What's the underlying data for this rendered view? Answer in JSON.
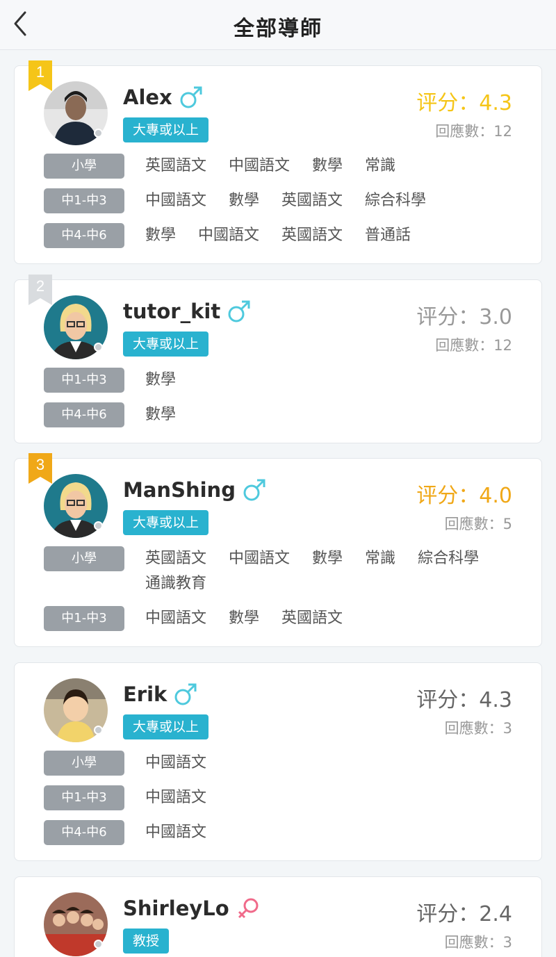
{
  "header": {
    "title": "全部導師"
  },
  "colors": {
    "accent": "#29b2cf",
    "gold": "#f5c518",
    "silver": "#d9dcdf",
    "bronze": "#f0a818",
    "male": "#4ec9dd",
    "female": "#f06a8a"
  },
  "tutors": [
    {
      "rank": "1",
      "name": "Alex",
      "gender": "male",
      "education": "大專或以上",
      "score": "评分：4.3",
      "responses": "回應數：12",
      "levels": [
        {
          "label": "小學",
          "subjects": [
            "英國語文",
            "中國語文",
            "數學",
            "常識"
          ]
        },
        {
          "label": "中1-中3",
          "subjects": [
            "中國語文",
            "數學",
            "英國語文",
            "綜合科學"
          ]
        },
        {
          "label": "中4-中6",
          "subjects": [
            "數學",
            "中國語文",
            "英國語文",
            "普通話"
          ]
        }
      ]
    },
    {
      "rank": "2",
      "name": "tutor_kit",
      "gender": "male",
      "education": "大專或以上",
      "score": "评分：3.0",
      "responses": "回應數：12",
      "levels": [
        {
          "label": "中1-中3",
          "subjects": [
            "數學"
          ]
        },
        {
          "label": "中4-中6",
          "subjects": [
            "數學"
          ]
        }
      ]
    },
    {
      "rank": "3",
      "name": "ManShing",
      "gender": "male",
      "education": "大專或以上",
      "score": "评分：4.0",
      "responses": "回應數：5",
      "levels": [
        {
          "label": "小學",
          "subjects": [
            "英國語文",
            "中國語文",
            "數學",
            "常識",
            "綜合科學",
            "通識教育"
          ]
        },
        {
          "label": "中1-中3",
          "subjects": [
            "中國語文",
            "數學",
            "英國語文"
          ]
        }
      ]
    },
    {
      "rank": "",
      "name": "Erik",
      "gender": "male",
      "education": "大專或以上",
      "score": "评分：4.3",
      "responses": "回應數：3",
      "levels": [
        {
          "label": "小學",
          "subjects": [
            "中國語文"
          ]
        },
        {
          "label": "中1-中3",
          "subjects": [
            "中國語文"
          ]
        },
        {
          "label": "中4-中6",
          "subjects": [
            "中國語文"
          ]
        }
      ]
    },
    {
      "rank": "",
      "name": "ShirleyLo",
      "gender": "female",
      "education": "教授",
      "score": "评分：2.4",
      "responses": "回應數：3",
      "levels": []
    }
  ]
}
